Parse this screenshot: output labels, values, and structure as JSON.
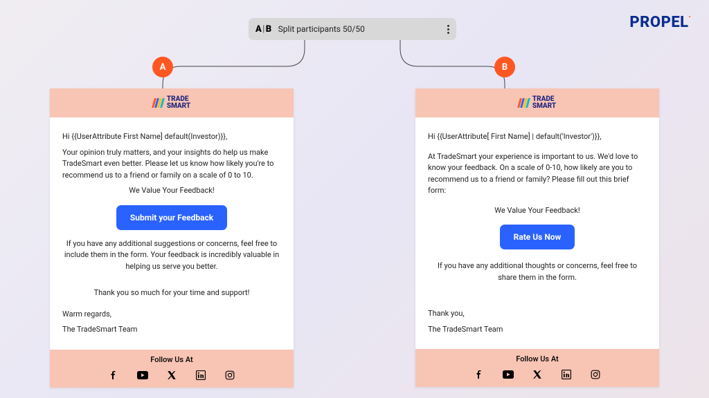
{
  "logo": "PROPEL",
  "topbar": {
    "abIcon": "A|B",
    "label": "Split participants 50/50"
  },
  "badgeA": "A",
  "badgeB": "B",
  "brand": {
    "line1": "TRADE",
    "line2": "SMART"
  },
  "cardA": {
    "greeting": "Hi {{UserAttribute First Name] default(Investor)}},",
    "p1": "Your opinion  truly matters, and your  insights do help us  make TradeSmart even better. Please let us know how likely you're to recommend us to a friend or family on a scale of 0 to 10.",
    "valueLine": "We Value Your Feedback!",
    "cta": "Submit your Feedback",
    "p2": "If you have any additional suggestions or concerns, feel free to include them in the form. Your feedback is incredibly valuable in helping us serve you better.",
    "thanks": "Thank you so much for your time and support!",
    "regards": "Warm regards,",
    "team": "The TradeSmart Team"
  },
  "cardB": {
    "greeting": "Hi {{UserAttribute[ First Name] | default('Investor')}},",
    "p1": "At TradeSmart your experience is important to us. We'd love to know your feedback. On a scale of 0-10, how likely are you to recommend us to a friend or family? Please fill out this brief form:",
    "valueLine": "We Value Your Feedback!",
    "cta": "Rate Us Now",
    "p2": "If you have any additional thoughts or concerns, feel free to share them in the form.",
    "thanks": "Thank you,",
    "team": "The TradeSmart Team"
  },
  "footer": {
    "follow": "Follow Us At"
  }
}
